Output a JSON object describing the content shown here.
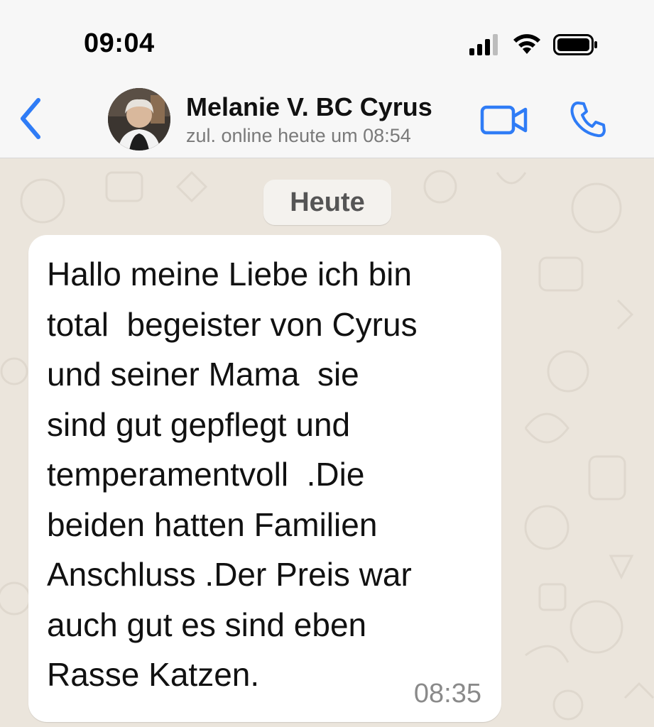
{
  "status_bar": {
    "time": "09:04"
  },
  "header": {
    "back_icon": "chevron-left-icon",
    "contact_name": "Melanie V. BC Cyrus",
    "contact_status": "zul. online heute um 08:54",
    "video_icon": "video-camera-icon",
    "call_icon": "phone-icon"
  },
  "chat": {
    "date_label": "Heute",
    "messages": [
      {
        "text": "Hallo meine Liebe ich bin\ntotal  begeister von Cyrus\nund seiner Mama  sie\nsind gut gepflegt und\ntemperamentvoll  .Die\nbeiden hatten Familien\nAnschluss .Der Preis war\nauch gut es sind eben\nRasse Katzen.",
        "time": "08:35"
      }
    ]
  },
  "colors": {
    "accent": "#2f7cf6",
    "header_bg": "#f7f7f7",
    "wallpaper": "#ebe5dc",
    "bubble": "#ffffff"
  }
}
